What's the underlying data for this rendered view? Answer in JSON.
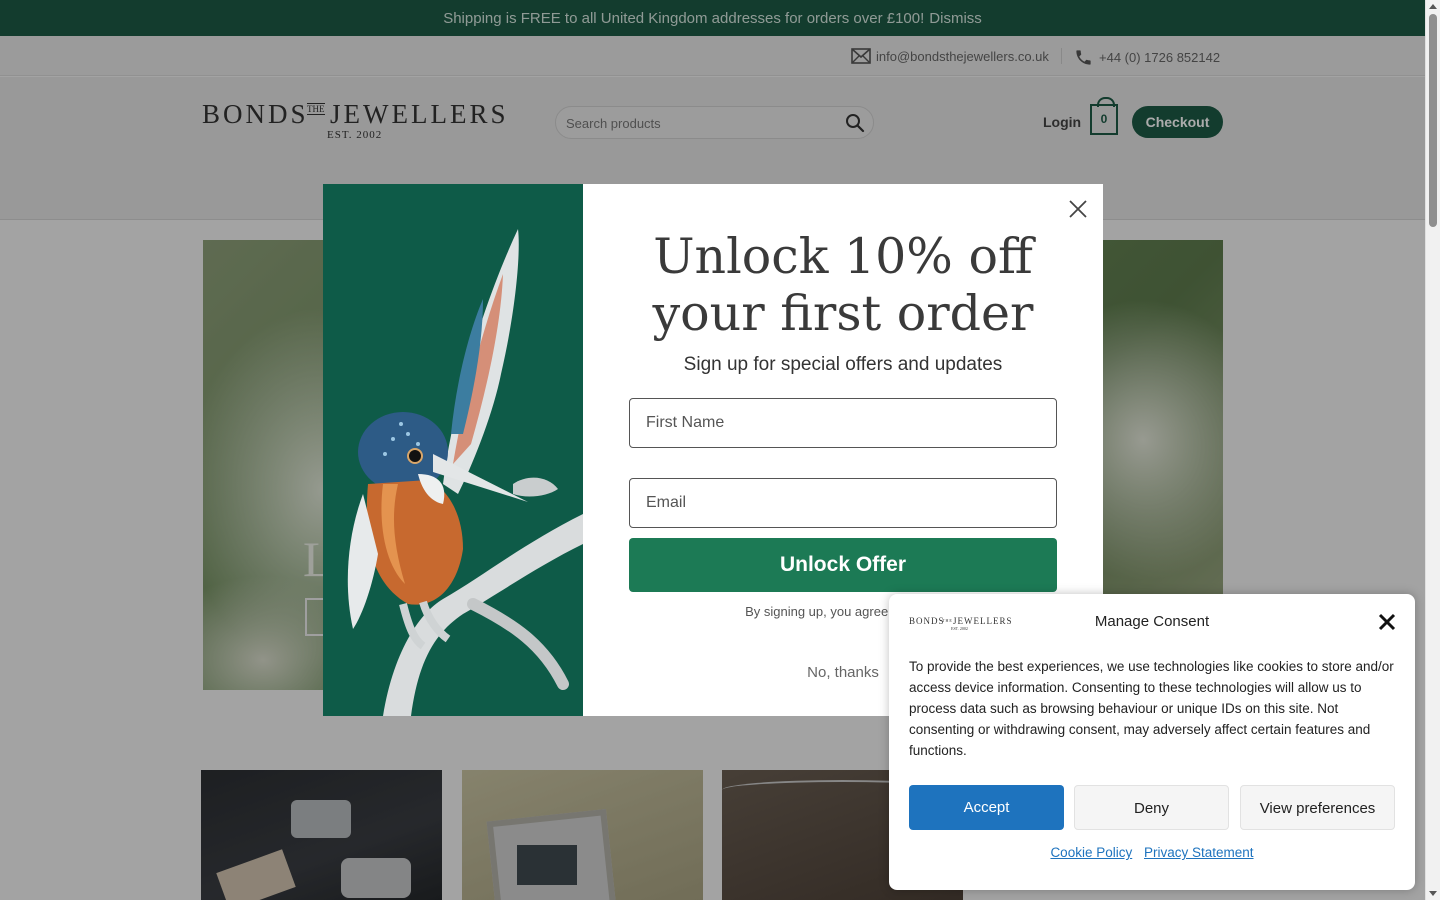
{
  "banner": {
    "text": "Shipping is FREE to all United Kingdom addresses for orders over £100!",
    "dismiss": "Dismiss",
    "color": "#1d5a45"
  },
  "topbar": {
    "email": "info@bondsthejewellers.co.uk",
    "phone": "+44 (0) 1726 852142",
    "email_icon": "envelope-icon",
    "phone_icon": "phone-icon"
  },
  "header": {
    "logo": {
      "word1": "BONDS",
      "the": "THE",
      "word2": "JEWELLERS",
      "est": "EST. 2002"
    },
    "search_placeholder": "Search products",
    "login": "Login",
    "cart_count": "0",
    "checkout": "Checkout"
  },
  "popup": {
    "title": "Unlock 10% off your first order",
    "subtitle": "Sign up for special offers and updates",
    "first_name_placeholder": "First Name",
    "email_placeholder": "Email",
    "button": "Unlock Offer",
    "terms": "By signing up, you agree to receiv",
    "no_thanks": "No, thanks",
    "accent": "#1c7a55"
  },
  "consent": {
    "logo_word1": "BONDS",
    "logo_the": "THE",
    "logo_word2": "JEWELLERS",
    "logo_est": "EST. 2002",
    "title": "Manage Consent",
    "text": "To provide the best experiences, we use technologies like cookies to store and/or access device information. Consenting to these technologies will allow us to process data such as browsing behaviour or unique IDs on this site. Not consenting or withdrawing consent, may adversely affect certain features and functions.",
    "accept": "Accept",
    "deny": "Deny",
    "view_preferences": "View preferences",
    "cookie_policy": "Cookie Policy",
    "privacy_statement": "Privacy Statement",
    "accent": "#1e73be"
  },
  "hero": {
    "letter": "L"
  }
}
